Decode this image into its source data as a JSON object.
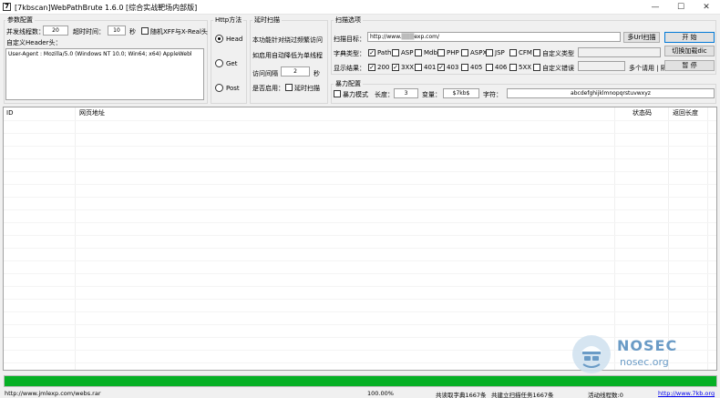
{
  "window": {
    "title": "[7kbscan]WebPathBrute 1.6.0",
    "subtitle": "[综合实战靶场内部版]",
    "app_icon": "7",
    "controls": {
      "minimize": "—",
      "maximize": "☐",
      "close": "✕"
    }
  },
  "params": {
    "group_title": "参数配置",
    "threads_label": "并发线程数：",
    "threads_value": "20",
    "timeout_label": "超时时间：",
    "timeout_value": "10",
    "timeout_unit": "秒",
    "random_xff_label": "随机XFF与X-Real头",
    "random_xff_checked": false,
    "header_label": "自定义Header头：",
    "header_value": "User-Agent : Mozilla/5.0 (Windows NT 10.0; Win64; x64) AppleWebl"
  },
  "http": {
    "group_title": "Http方法",
    "options": [
      {
        "label": "Head",
        "selected": true
      },
      {
        "label": "Get",
        "selected": false
      },
      {
        "label": "Post",
        "selected": false
      }
    ]
  },
  "delay": {
    "group_title": "延时扫描",
    "desc1": "本功能针对绕过频繁访问",
    "desc2": "如启用自动降低为单线程",
    "interval_label": "访问间隔",
    "interval_value": "2",
    "interval_unit": "秒",
    "enable_label": "是否启用：",
    "enable_option": "延时扫描",
    "enable_checked": false
  },
  "scan": {
    "group_title": "扫描选项",
    "target_label": "扫描目标：",
    "target_value": "http://www.",
    "target_masked": "███",
    "target_suffix": "exp.com/",
    "multi_url_button": "多Url扫描",
    "start_button": "开 始",
    "dict_type_label": "字典类型：",
    "dict_types": [
      {
        "label": "Path",
        "checked": true
      },
      {
        "label": "ASP",
        "checked": false
      },
      {
        "label": "Mdb",
        "checked": false
      },
      {
        "label": "PHP",
        "checked": false
      },
      {
        "label": "ASPX",
        "checked": false
      },
      {
        "label": "JSP",
        "checked": false
      },
      {
        "label": "CFM",
        "checked": false
      },
      {
        "label": "自定义类型",
        "checked": false
      }
    ],
    "switch_dict_button": "切换加载dic",
    "result_label": "显示结果：",
    "result_codes": [
      {
        "label": "200",
        "checked": true
      },
      {
        "label": "3XX",
        "checked": true
      },
      {
        "label": "401",
        "checked": false
      },
      {
        "label": "403",
        "checked": true
      },
      {
        "label": "405",
        "checked": false
      },
      {
        "label": "406",
        "checked": false
      },
      {
        "label": "5XX",
        "checked": false
      },
      {
        "label": "自定义错误",
        "checked": false
      }
    ],
    "multi_sep_label": "多个请用 | 隔开",
    "pause_button": "暂 停"
  },
  "brute": {
    "group_title": "暴力配置",
    "mode_label": "暴力模式",
    "mode_checked": false,
    "length_label": "长度：",
    "length_value": "3",
    "var_label": "变量：",
    "var_value": "$7kb$",
    "chars_label": "字符：",
    "chars_value": "abcdefghijklmnopqrstuvwxyz"
  },
  "table": {
    "columns": [
      "ID",
      "网页地址",
      "状态码",
      "返回长度"
    ]
  },
  "progress": {
    "percent": 100
  },
  "watermark": {
    "brand": "NOSEC",
    "domain": "nosec.org"
  },
  "status": {
    "left": "http://www.jmlexp.com/webs.rar",
    "percent": "100.00%",
    "dict_count": "共读取字典1667条",
    "task_count": "共建立扫描任务1667条",
    "threads": "活动线程数:0",
    "link": "http://www.7kb.org"
  }
}
